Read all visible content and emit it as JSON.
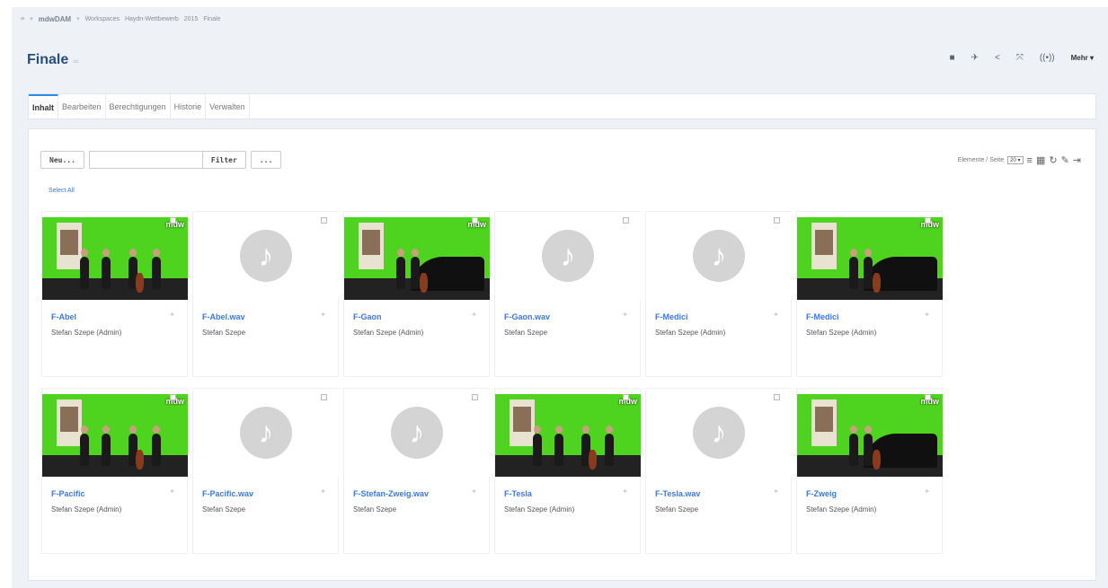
{
  "breadcrumb": {
    "brand": "mdwDAM",
    "items": [
      "Workspaces",
      "Haydn-Wettbewerb",
      "2015",
      "Finale"
    ]
  },
  "page": {
    "title": "Finale",
    "more_label": "Mehr ▾"
  },
  "tabs": [
    "Inhalt",
    "Bearbeiten",
    "Berechtigungen",
    "Historie",
    "Verwalten"
  ],
  "toolbar": {
    "new_label": "Neu...",
    "filter_label": "Filter",
    "more_label": "...",
    "search_value": "",
    "select_all": "Select All",
    "per_page_label": "Elemente / Seite",
    "per_page_value": "20 ▾"
  },
  "cards": [
    {
      "title": "F-Abel",
      "owner": "Stefan Szepe (Admin)",
      "kind": "video",
      "scene": "quartet"
    },
    {
      "title": "F-Abel.wav",
      "owner": "Stefan Szepe",
      "kind": "audio"
    },
    {
      "title": "F-Gaon",
      "owner": "Stefan Szepe (Admin)",
      "kind": "video",
      "scene": "piano"
    },
    {
      "title": "F-Gaon.wav",
      "owner": "Stefan Szepe",
      "kind": "audio"
    },
    {
      "title": "F-Medici",
      "owner": "Stefan Szepe (Admin)",
      "kind": "audio"
    },
    {
      "title": "F-Medici",
      "owner": "Stefan Szepe (Admin)",
      "kind": "video",
      "scene": "piano"
    },
    {
      "title": "F-Pacific",
      "owner": "Stefan Szepe (Admin)",
      "kind": "video",
      "scene": "quartet"
    },
    {
      "title": "F-Pacific.wav",
      "owner": "Stefan Szepe",
      "kind": "audio"
    },
    {
      "title": "F-Stefan-Zweig.wav",
      "owner": "Stefan Szepe",
      "kind": "audio"
    },
    {
      "title": "F-Tesla",
      "owner": "Stefan Szepe (Admin)",
      "kind": "video",
      "scene": "quartet"
    },
    {
      "title": "F-Tesla.wav",
      "owner": "Stefan Szepe",
      "kind": "audio"
    },
    {
      "title": "F-Zweig",
      "owner": "Stefan Szepe (Admin)",
      "kind": "video",
      "scene": "piano"
    }
  ],
  "icons": {
    "menu": "hamburger-icon",
    "audio": "music-note-icon",
    "video_watermark": "mdw"
  },
  "colors": {
    "accent": "#2d8be8",
    "link": "#3b7ad4",
    "title": "#2a4d80",
    "video_bg": "#4ed31e"
  }
}
